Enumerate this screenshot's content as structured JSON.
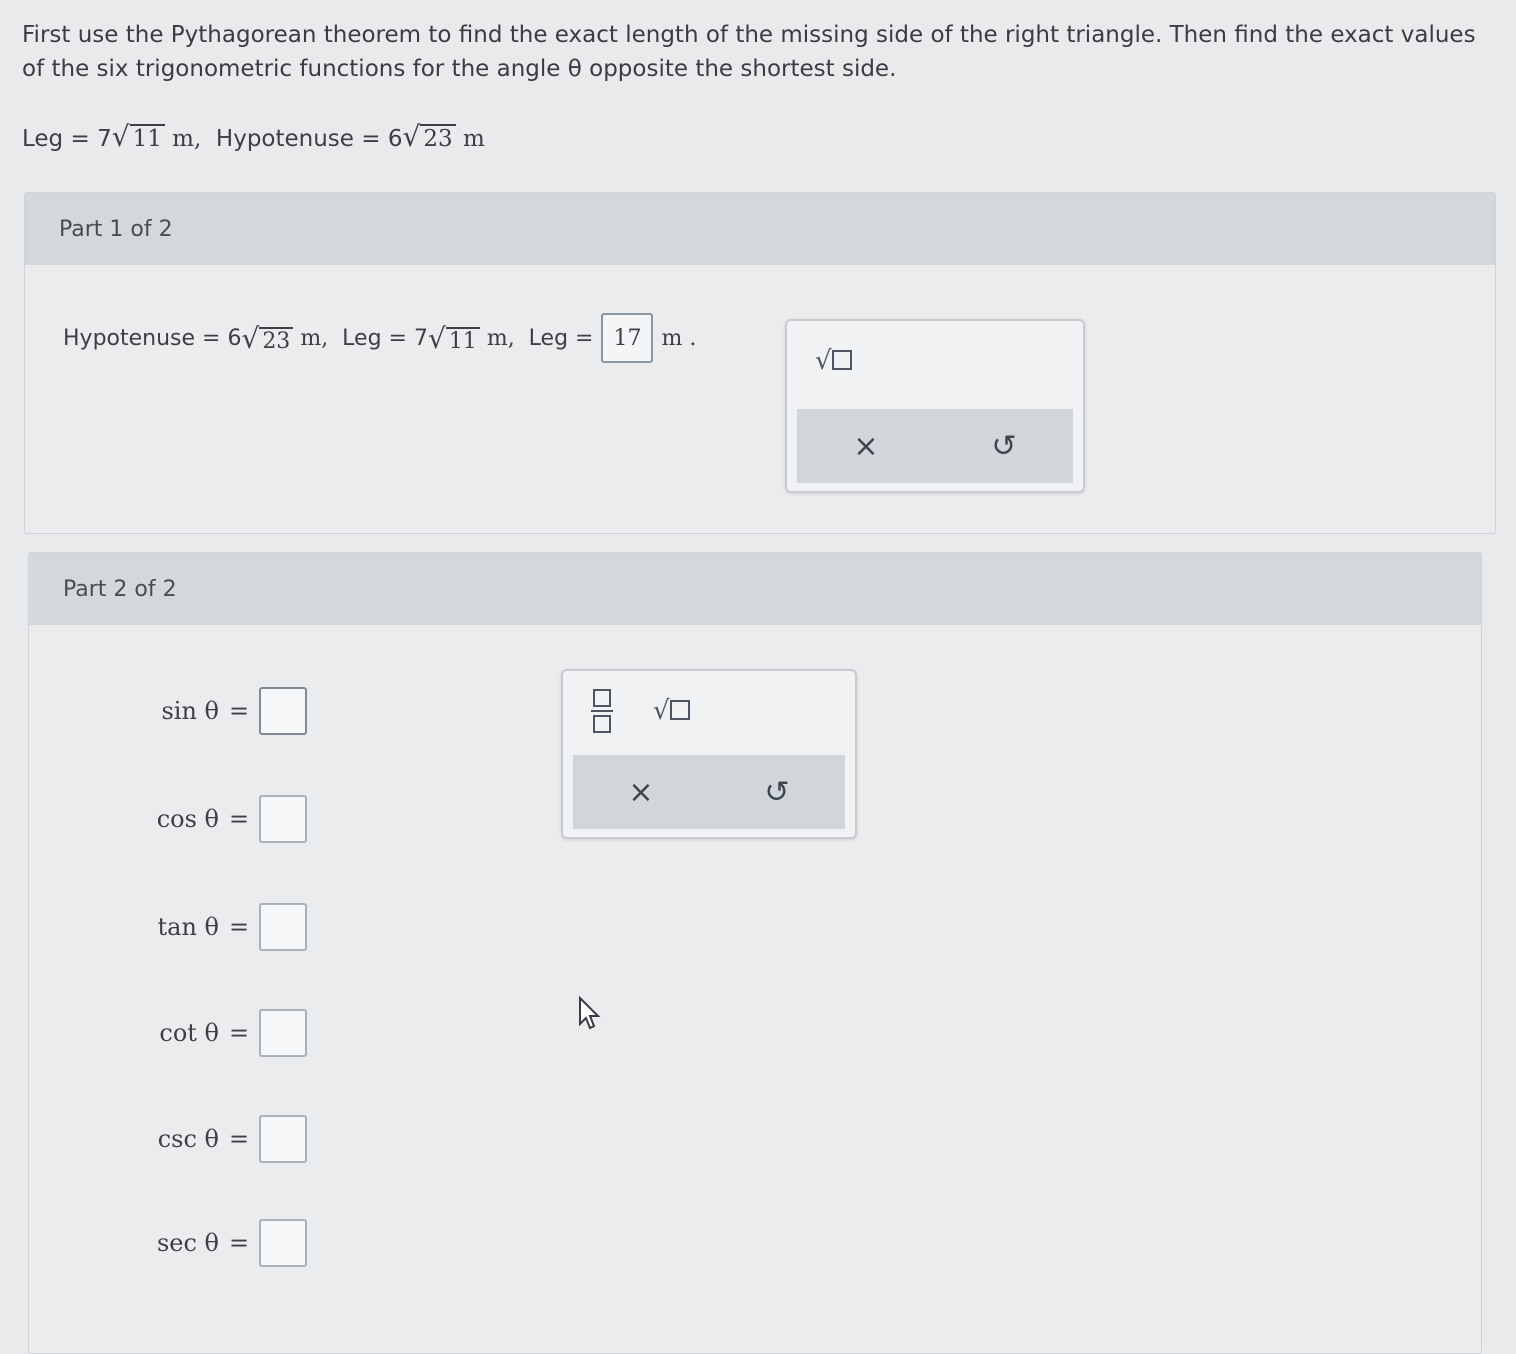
{
  "prompt": "First use the Pythagorean theorem to find the exact length of the missing side of the right triangle. Then find the exact values of the six trigonometric functions for the angle θ opposite the shortest side.",
  "given": {
    "leg_label": "Leg",
    "leg_coef": "7",
    "leg_rad": "11",
    "unit": "m",
    "hyp_label": "Hypotenuse",
    "hyp_coef": "6",
    "hyp_rad": "23"
  },
  "part1": {
    "header": "Part 1 of 2",
    "hyp_label": "Hypotenuse",
    "hyp_coef": "6",
    "hyp_rad": "23",
    "leg1_label": "Leg",
    "leg1_coef": "7",
    "leg1_rad": "11",
    "leg2_label": "Leg",
    "leg2_value": "17",
    "unit": "m"
  },
  "part2": {
    "header": "Part 2 of 2",
    "functions": [
      {
        "label": "sin θ",
        "value": ""
      },
      {
        "label": "cos θ",
        "value": ""
      },
      {
        "label": "tan θ",
        "value": ""
      },
      {
        "label": "cot θ",
        "value": ""
      },
      {
        "label": "csc θ",
        "value": ""
      },
      {
        "label": "sec θ",
        "value": ""
      }
    ]
  },
  "toolbox": {
    "clear_symbol": "×",
    "undo_symbol": "↺",
    "sqrt_symbol": "√"
  }
}
